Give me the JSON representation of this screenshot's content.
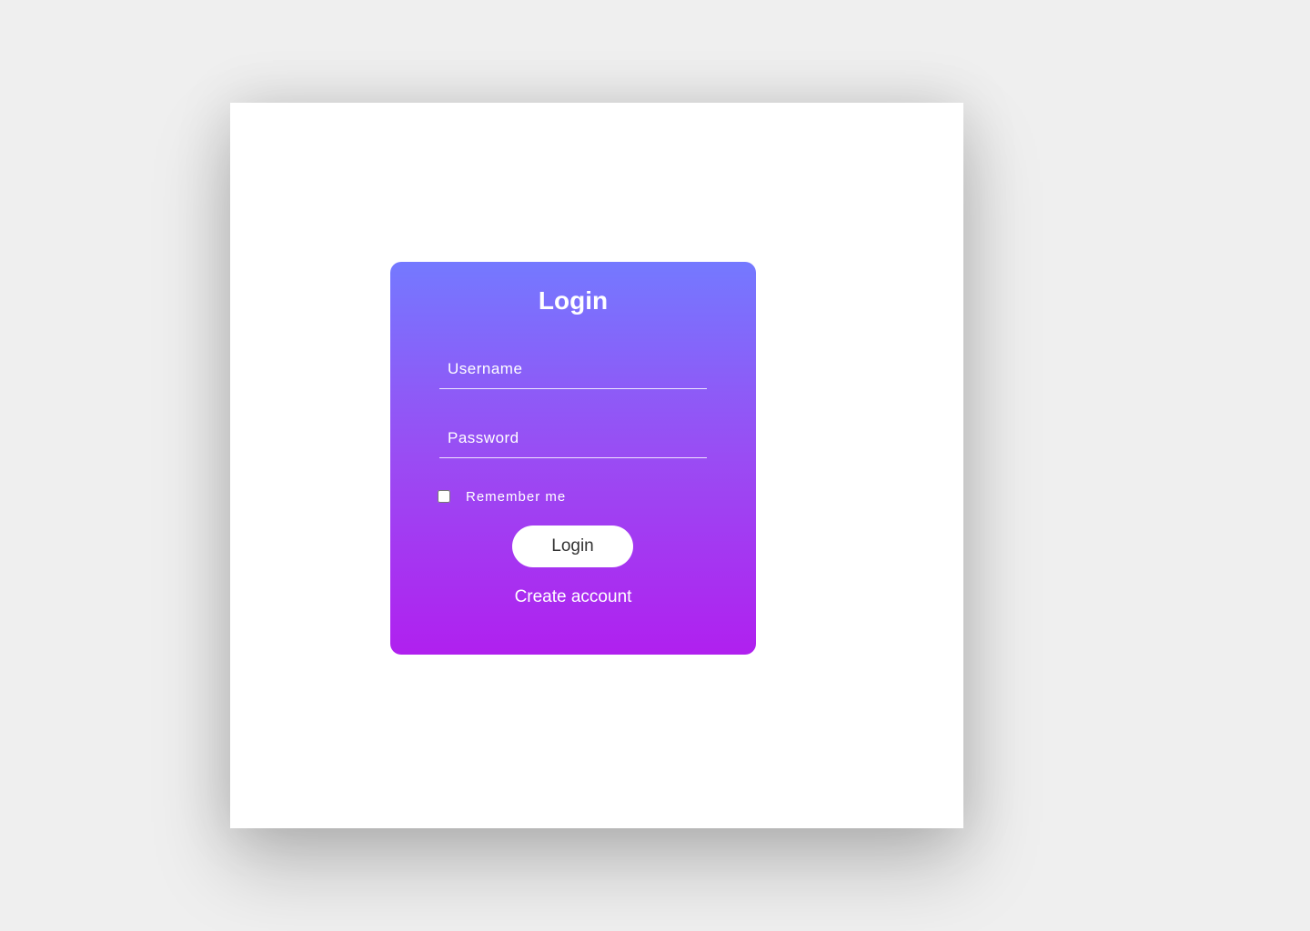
{
  "login_card": {
    "title": "Login",
    "username": {
      "placeholder": "Username",
      "value": ""
    },
    "password": {
      "placeholder": "Password",
      "value": ""
    },
    "remember": {
      "label": "Remember me",
      "checked": false
    },
    "submit_label": "Login",
    "create_account_label": "Create account"
  },
  "colors": {
    "page_background": "#efefef",
    "frame_background": "#ffffff",
    "gradient_top": "#7479ff",
    "gradient_bottom": "#b020ef",
    "button_background": "#ffffff",
    "button_text": "#333333"
  }
}
